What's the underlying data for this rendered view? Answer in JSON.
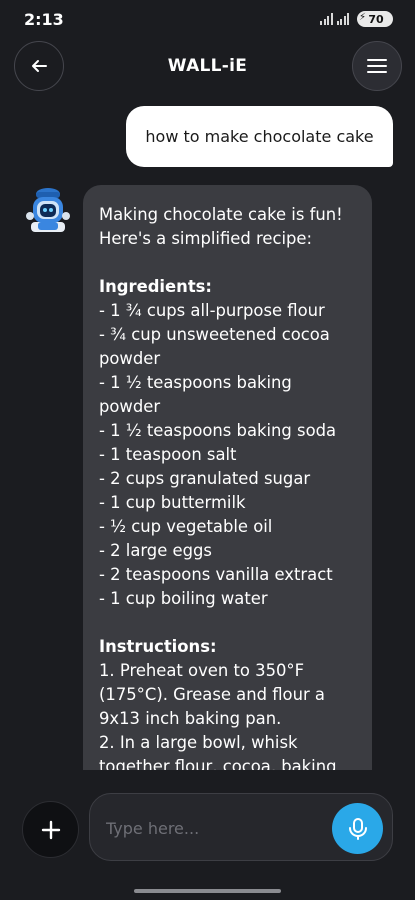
{
  "status_bar": {
    "time": "2:13",
    "battery": "70"
  },
  "header": {
    "title": "WALL-iE",
    "back_icon": "arrow-left-icon",
    "menu_icon": "hamburger-menu-icon"
  },
  "user_message": {
    "text": "how to make chocolate cake"
  },
  "bot_message": {
    "avatar_icon": "robot-avatar-icon",
    "lines": [
      {
        "text": "Making chocolate cake is fun!",
        "bold": false
      },
      {
        "text": "Here's a simplified recipe:",
        "bold": false
      },
      {
        "text": "",
        "bold": false
      },
      {
        "text": "Ingredients:",
        "bold": true
      },
      {
        "text": "- 1 ¾ cups all-purpose flour",
        "bold": false
      },
      {
        "text": "- ¾ cup unsweetened cocoa",
        "bold": false
      },
      {
        "text": "powder",
        "bold": false
      },
      {
        "text": "- 1 ½ teaspoons baking",
        "bold": false
      },
      {
        "text": "powder",
        "bold": false
      },
      {
        "text": "- 1 ½ teaspoons baking soda",
        "bold": false
      },
      {
        "text": "- 1 teaspoon salt",
        "bold": false
      },
      {
        "text": "- 2 cups granulated sugar",
        "bold": false
      },
      {
        "text": "- 1 cup buttermilk",
        "bold": false
      },
      {
        "text": "- ½ cup vegetable oil",
        "bold": false
      },
      {
        "text": "- 2 large eggs",
        "bold": false
      },
      {
        "text": "- 2 teaspoons vanilla extract",
        "bold": false
      },
      {
        "text": "- 1 cup boiling water",
        "bold": false
      },
      {
        "text": "",
        "bold": false
      },
      {
        "text": "Instructions:",
        "bold": true
      },
      {
        "text": "1. Preheat oven to 350°F",
        "bold": false
      },
      {
        "text": "(175°C). Grease and flour a",
        "bold": false
      },
      {
        "text": "9x13 inch baking pan.",
        "bold": false
      },
      {
        "text": "2. In a large bowl, whisk",
        "bold": false
      },
      {
        "text": "together flour, cocoa, baking",
        "bold": false
      }
    ]
  },
  "composer": {
    "placeholder": "Type here...",
    "add_icon": "plus-icon",
    "mic_icon": "microphone-icon"
  },
  "colors": {
    "background": "#1b1c20",
    "bot_bubble": "#3b3c41",
    "user_bubble": "#ffffff",
    "accent": "#2aa8e8"
  }
}
